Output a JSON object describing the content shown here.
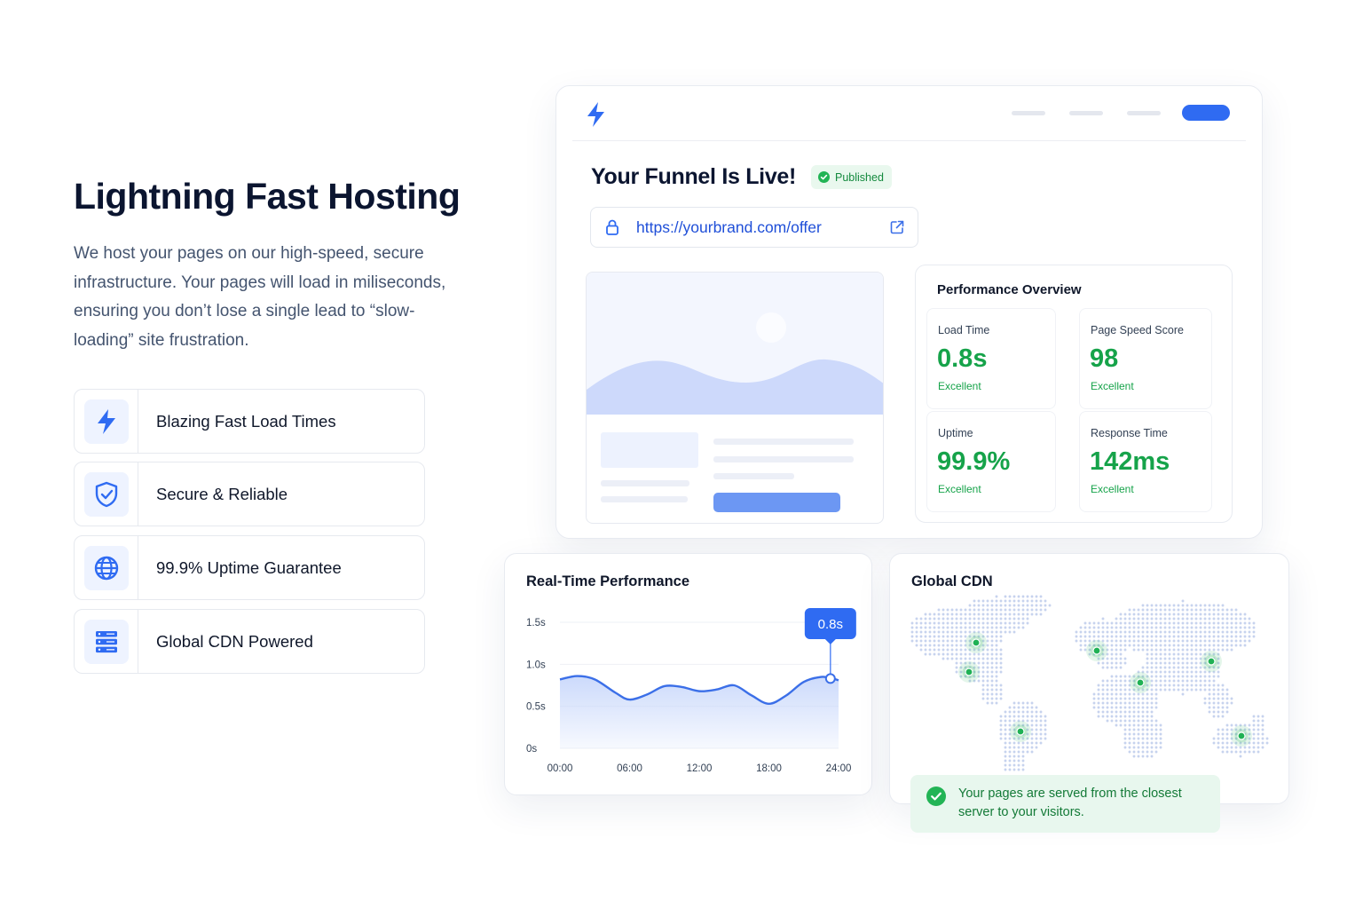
{
  "hero": {
    "title": "Lightning Fast Hosting",
    "description": "We host your pages on our high-speed, secure infrastructure. Your pages will load in miliseconds, ensuring you don’t lose a single lead to “slow-loading” site frustration."
  },
  "features": [
    {
      "label": "Blazing Fast Load Times",
      "icon": "lightning-bolt-icon"
    },
    {
      "label": "Secure & Reliable",
      "icon": "shield-check-icon"
    },
    {
      "label": "99.9% Uptime Guarantee",
      "icon": "globe-icon"
    },
    {
      "label": "Global CDN Powered",
      "icon": "server-stack-icon"
    }
  ],
  "funnel": {
    "title": "Your Funnel Is Live!",
    "badge": "Published",
    "url": "https://yourbrand.com/offer"
  },
  "performance": {
    "title": "Performance Overview",
    "metrics": [
      {
        "label": "Load Time",
        "value": "0.8s",
        "rating": "Excellent"
      },
      {
        "label": "Page Speed Score",
        "value": "98",
        "rating": "Excellent"
      },
      {
        "label": "Uptime",
        "value": "99.9%",
        "rating": "Excellent"
      },
      {
        "label": "Response Time",
        "value": "142ms",
        "rating": "Excellent"
      }
    ]
  },
  "realtime": {
    "title": "Real-Time Performance",
    "tooltip": "0.8s"
  },
  "chart_data": {
    "type": "area",
    "title": "Real-Time Performance",
    "x_ticks": [
      "00:00",
      "06:00",
      "12:00",
      "18:00",
      "24:00"
    ],
    "y_ticks": [
      "0s",
      "0.5s",
      "1.0s",
      "1.5s"
    ],
    "ylim": [
      0,
      1.5
    ],
    "xlim": [
      0,
      24
    ],
    "grid": true,
    "series": [
      {
        "x": [
          0,
          1.5,
          3,
          4.8,
          6,
          7.5,
          9,
          10.5,
          12,
          13.5,
          15,
          16.5,
          18,
          19.5,
          21,
          22.5,
          23.5,
          24
        ],
        "values": [
          0.82,
          0.86,
          0.82,
          0.66,
          0.58,
          0.64,
          0.74,
          0.73,
          0.68,
          0.7,
          0.75,
          0.63,
          0.53,
          0.63,
          0.79,
          0.85,
          0.83,
          0.81
        ]
      }
    ],
    "highlight": {
      "x": 23.3,
      "y": 0.83,
      "label": "0.8s"
    },
    "colors": {
      "line": "#3b6fe8",
      "fill": "#c9d8fb",
      "tooltip": "#2f6bf2"
    }
  },
  "cdn": {
    "title": "Global CDN",
    "note": "Your pages are served from the closest server to your visitors."
  },
  "colors": {
    "accent": "#2f6bf2",
    "success": "#16a34a",
    "heading": "#0b1530",
    "body": "#44546f"
  }
}
